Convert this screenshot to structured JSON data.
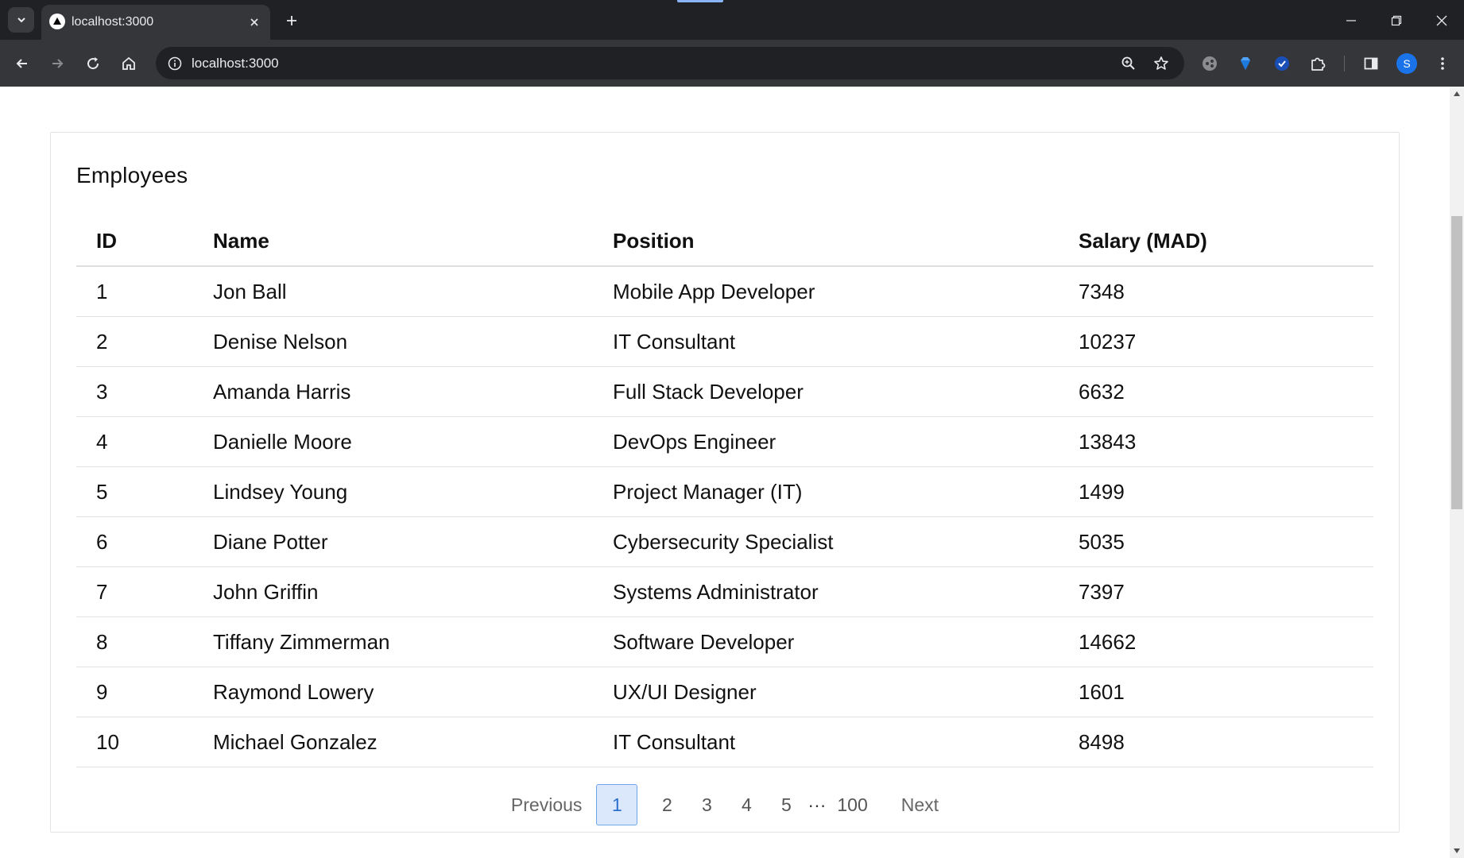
{
  "browser": {
    "tab_title": "localhost:3000",
    "url": "localhost:3000",
    "avatar_letter": "S"
  },
  "page": {
    "title": "Employees",
    "columns": [
      "ID",
      "Name",
      "Position",
      "Salary (MAD)"
    ],
    "rows": [
      {
        "id": "1",
        "name": "Jon Ball",
        "position": "Mobile App Developer",
        "salary": "7348"
      },
      {
        "id": "2",
        "name": "Denise Nelson",
        "position": "IT Consultant",
        "salary": "10237"
      },
      {
        "id": "3",
        "name": "Amanda Harris",
        "position": "Full Stack Developer",
        "salary": "6632"
      },
      {
        "id": "4",
        "name": "Danielle Moore",
        "position": "DevOps Engineer",
        "salary": "13843"
      },
      {
        "id": "5",
        "name": "Lindsey Young",
        "position": "Project Manager (IT)",
        "salary": "1499"
      },
      {
        "id": "6",
        "name": "Diane Potter",
        "position": "Cybersecurity Specialist",
        "salary": "5035"
      },
      {
        "id": "7",
        "name": "John Griffin",
        "position": "Systems Administrator",
        "salary": "7397"
      },
      {
        "id": "8",
        "name": "Tiffany Zimmerman",
        "position": "Software Developer",
        "salary": "14662"
      },
      {
        "id": "9",
        "name": "Raymond Lowery",
        "position": "UX/UI Designer",
        "salary": "1601"
      },
      {
        "id": "10",
        "name": "Michael Gonzalez",
        "position": "IT Consultant",
        "salary": "8498"
      }
    ],
    "pagination": {
      "previous": "Previous",
      "pages": [
        "1",
        "2",
        "3",
        "4",
        "5"
      ],
      "ellipsis": "···",
      "last": "100",
      "next": "Next",
      "current": "1"
    }
  },
  "colors": {
    "chrome_bg": "#202124",
    "toolbar_bg": "#35363a",
    "active_page_bg": "#dbe8fb",
    "active_page_border": "#6ea5e9",
    "active_page_text": "#2b6fcf"
  }
}
